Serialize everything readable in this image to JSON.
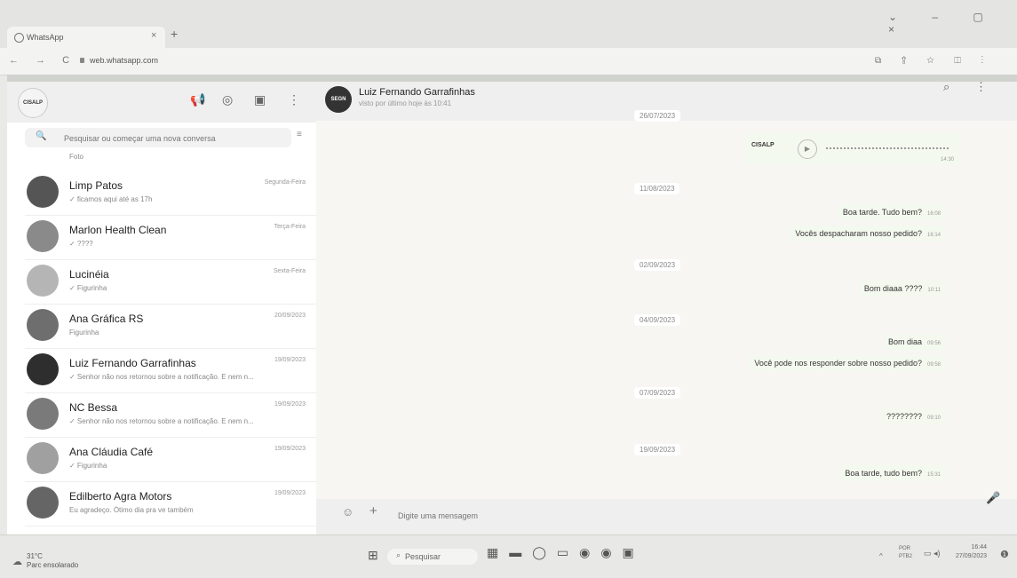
{
  "browser": {
    "tab_title": "WhatsApp",
    "tab_close": "×",
    "new_tab": "+",
    "url": "web.whatsapp.com",
    "nav_glyphs": "← → C",
    "window_controls": "⌄ – ▢ ×",
    "toolbar_glyphs": "⧉ ⇪ ☆ ◫ ⋮"
  },
  "sidebar": {
    "logo_text": "CISALP",
    "search_placeholder": "Pesquisar ou começar uma nova conversa",
    "partial_preview": "Foto",
    "chats": [
      {
        "name": "Limp Patos",
        "preview": "✓ ficamos aqui até as 17h",
        "time": "Segunda-Feira"
      },
      {
        "name": "Marlon Health Clean",
        "preview": "✓ ????",
        "time": "Terça-Feira"
      },
      {
        "name": "Lucinéia",
        "preview": "✓ Figurinha",
        "time": "Sexta-Feira"
      },
      {
        "name": "Ana Gráfica RS",
        "preview": "Figurinha",
        "time": "20/09/2023"
      },
      {
        "name": "Luiz Fernando Garrafinhas",
        "preview": "✓ Senhor não nos retornou sobre a notificação. E nem n...",
        "time": "19/09/2023"
      },
      {
        "name": "NC Bessa",
        "preview": "✓ Senhor não nos retornou sobre a notificação. E nem n...",
        "time": "19/09/2023"
      },
      {
        "name": "Ana Cláudia Café",
        "preview": "✓ Figurinha",
        "time": "19/09/2023"
      },
      {
        "name": "Edilberto Agra Motors",
        "preview": "Eu agradeço. Ótimo dia pra ve também",
        "time": "19/09/2023"
      }
    ]
  },
  "conversation": {
    "contact_name": "Luiz Fernando Garrafinhas",
    "avatar_text": "SEGN",
    "status": "visto por último hoje às 10:41",
    "dates": [
      "26/07/2023",
      "11/08/2023",
      "02/09/2023",
      "04/09/2023",
      "07/09/2023",
      "19/09/2023"
    ],
    "audio": {
      "label": "CISALP",
      "time": "14:30"
    },
    "messages": [
      {
        "text": "Boa tarde. Tudo bem?",
        "time": "16:08"
      },
      {
        "text": "Vocês despacharam nosso pedido?",
        "time": "16:14"
      },
      {
        "text": "Bom diaaa ????",
        "time": "10:11"
      },
      {
        "text": "Bom diaa",
        "time": "09:56"
      },
      {
        "text": "Você pode nos responder sobre nosso pedido?",
        "time": "09:58"
      },
      {
        "text": "????????",
        "time": "09:10"
      },
      {
        "text": "Boa tarde, tudo bem?",
        "time": "15:31"
      }
    ],
    "composer_placeholder": "Digite uma mensagem"
  },
  "taskbar": {
    "weather_temp": "31°C",
    "weather_desc": "Parc ensolarado",
    "search_label": "Pesquisar",
    "lang_top": "POR",
    "lang_bottom": "PTB2",
    "time": "16:44",
    "date": "27/09/2023"
  }
}
